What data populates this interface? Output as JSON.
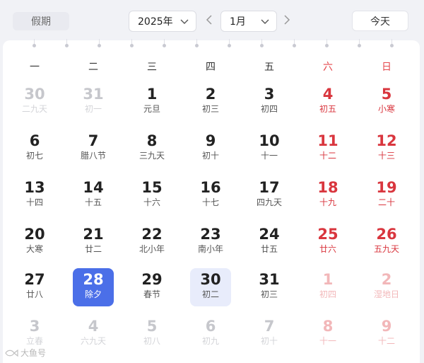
{
  "toolbar": {
    "holiday_label": "假期",
    "year_value": "2025年",
    "month_value": "1月",
    "today_label": "今天"
  },
  "weekdays": [
    "一",
    "二",
    "三",
    "四",
    "五",
    "六",
    "日"
  ],
  "weeks": [
    [
      {
        "day": "30",
        "lunar": "二九天",
        "state": "other"
      },
      {
        "day": "31",
        "lunar": "初一",
        "state": "other"
      },
      {
        "day": "1",
        "lunar": "元旦",
        "state": "normal"
      },
      {
        "day": "2",
        "lunar": "初三",
        "state": "normal"
      },
      {
        "day": "3",
        "lunar": "初四",
        "state": "normal"
      },
      {
        "day": "4",
        "lunar": "初五",
        "state": "weekend"
      },
      {
        "day": "5",
        "lunar": "小寒",
        "state": "weekend"
      }
    ],
    [
      {
        "day": "6",
        "lunar": "初七",
        "state": "normal"
      },
      {
        "day": "7",
        "lunar": "腊八节",
        "state": "normal"
      },
      {
        "day": "8",
        "lunar": "三九天",
        "state": "normal"
      },
      {
        "day": "9",
        "lunar": "初十",
        "state": "normal"
      },
      {
        "day": "10",
        "lunar": "十一",
        "state": "normal"
      },
      {
        "day": "11",
        "lunar": "十二",
        "state": "weekend"
      },
      {
        "day": "12",
        "lunar": "十三",
        "state": "weekend"
      }
    ],
    [
      {
        "day": "13",
        "lunar": "十四",
        "state": "normal"
      },
      {
        "day": "14",
        "lunar": "十五",
        "state": "normal"
      },
      {
        "day": "15",
        "lunar": "十六",
        "state": "normal"
      },
      {
        "day": "16",
        "lunar": "十七",
        "state": "normal"
      },
      {
        "day": "17",
        "lunar": "四九天",
        "state": "normal"
      },
      {
        "day": "18",
        "lunar": "十九",
        "state": "weekend"
      },
      {
        "day": "19",
        "lunar": "二十",
        "state": "weekend"
      }
    ],
    [
      {
        "day": "20",
        "lunar": "大寒",
        "state": "normal"
      },
      {
        "day": "21",
        "lunar": "廿二",
        "state": "normal"
      },
      {
        "day": "22",
        "lunar": "北小年",
        "state": "normal"
      },
      {
        "day": "23",
        "lunar": "南小年",
        "state": "normal"
      },
      {
        "day": "24",
        "lunar": "廿五",
        "state": "normal"
      },
      {
        "day": "25",
        "lunar": "廿六",
        "state": "weekend"
      },
      {
        "day": "26",
        "lunar": "五九天",
        "state": "weekend"
      }
    ],
    [
      {
        "day": "27",
        "lunar": "廿八",
        "state": "normal"
      },
      {
        "day": "28",
        "lunar": "除夕",
        "state": "selected"
      },
      {
        "day": "29",
        "lunar": "春节",
        "state": "normal"
      },
      {
        "day": "30",
        "lunar": "初二",
        "state": "hover"
      },
      {
        "day": "31",
        "lunar": "初三",
        "state": "normal"
      },
      {
        "day": "1",
        "lunar": "初四",
        "state": "other-weekend"
      },
      {
        "day": "2",
        "lunar": "湿地日",
        "state": "other-weekend"
      }
    ],
    [
      {
        "day": "3",
        "lunar": "立春",
        "state": "other"
      },
      {
        "day": "4",
        "lunar": "六九天",
        "state": "other"
      },
      {
        "day": "5",
        "lunar": "初八",
        "state": "other"
      },
      {
        "day": "6",
        "lunar": "初九",
        "state": "other"
      },
      {
        "day": "7",
        "lunar": "初十",
        "state": "other"
      },
      {
        "day": "8",
        "lunar": "十一",
        "state": "other-weekend"
      },
      {
        "day": "9",
        "lunar": "十二",
        "state": "other-weekend"
      }
    ]
  ],
  "watermark": "大鱼号",
  "colors": {
    "accent": "#4b6fe8",
    "weekend": "#d9363e",
    "hover": "#e8ecfb"
  }
}
